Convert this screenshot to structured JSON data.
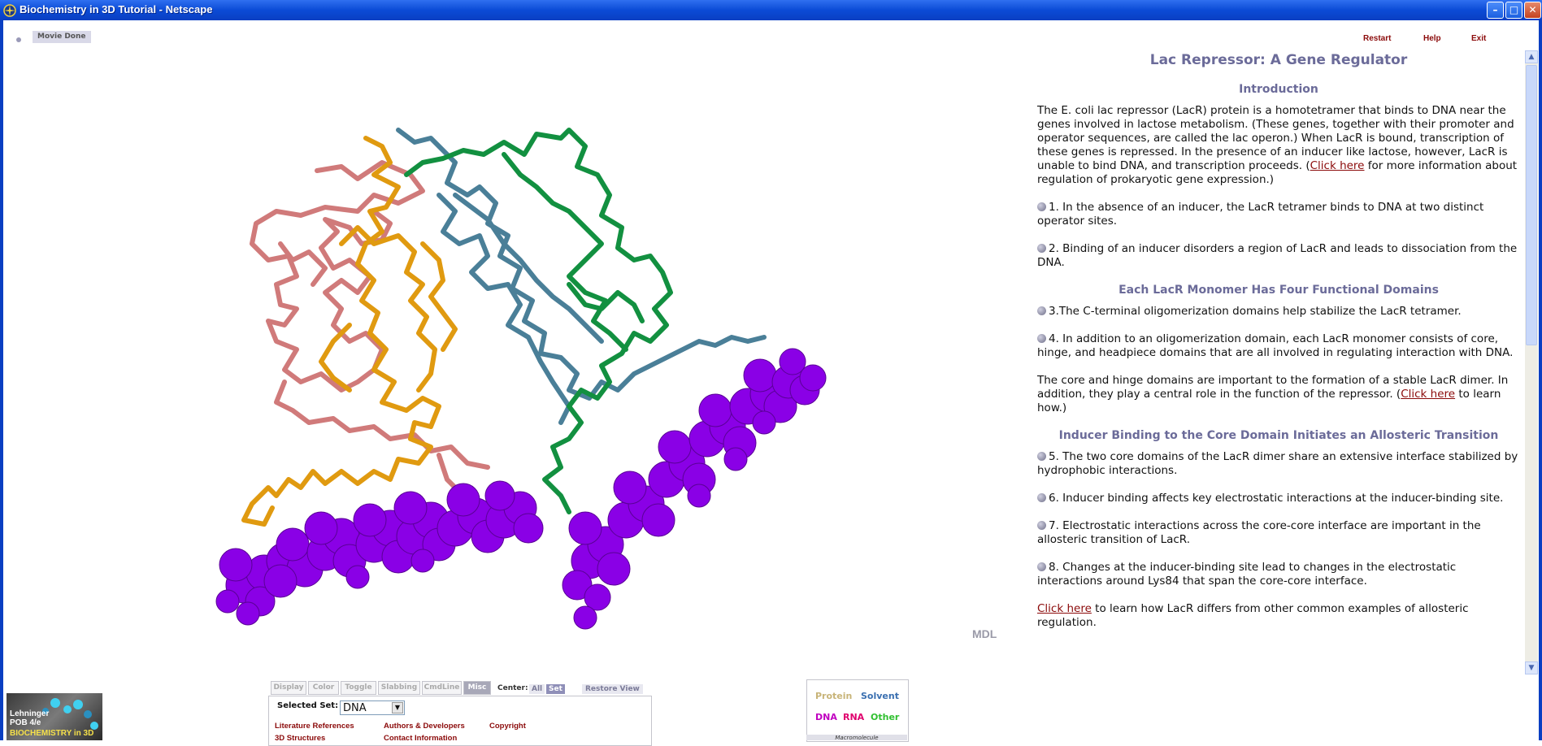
{
  "window": {
    "title": "Biochemistry in 3D Tutorial - Netscape",
    "minimize_glyph": "–",
    "maximize_glyph": "□",
    "close_glyph": "✕"
  },
  "toolbar": {
    "movie_label": "Movie Done"
  },
  "top_nav": {
    "restart": "Restart",
    "help": "Help",
    "exit": "Exit"
  },
  "content": {
    "title": "Lac Repressor: A Gene Regulator",
    "intro_heading": "Introduction",
    "intro_text_1": "The E. coli lac repressor (LacR) protein is a homotetramer that binds to DNA near the genes involved in lactose metabolism. (These genes, together with their promoter and operator sequences, are called the lac operon.) When LacR is bound, transcription of these genes is repressed. In the presence of an inducer like lactose, however, LacR is unable to bind DNA, and transcription proceeds. (",
    "intro_link": "Click here",
    "intro_text_2": " for more information about regulation of prokaryotic gene expression.)",
    "step1": "1. In the absence of an inducer, the LacR tetramer binds to DNA at two distinct operator sites.",
    "step2": "2. Binding of an inducer disorders a region of LacR and leads to dissociation from the DNA.",
    "domains_heading": "Each LacR Monomer Has Four Functional Domains",
    "step3": "3.The C-terminal oligomerization domains help stabilize the LacR tetramer.",
    "step4": "4. In addition to an oligomerization domain, each LacR monomer consists of core, hinge, and headpiece domains that are all involved in regulating interaction with DNA.",
    "core_text_1": "The core and hinge domains are important to the formation of a stable LacR dimer. In addition, they play a central role in the function of the repressor. (",
    "core_link": "Click here",
    "core_text_2": " to learn how.)",
    "inducer_heading": "Inducer Binding to the Core Domain Initiates an Allosteric Transition",
    "step5": "5. The two core domains of the LacR dimer share an extensive interface stabilized by hydrophobic interactions.",
    "step6": "6. Inducer binding affects key electrostatic interactions at the inducer-binding site.",
    "step7": "7. Electrostatic interactions across the core-core interface are important in the allosteric transition of LacR.",
    "step8": "8. Changes at the inducer-binding site lead to changes in the electrostatic interactions around Lys84 that span the core-core interface.",
    "last_link": "Click here",
    "last_text": " to learn how LacR differs from other common examples of allosteric regulation."
  },
  "viewer": {
    "watermark": "MDL"
  },
  "controls": {
    "tabs": [
      "Display",
      "Color",
      "Toggle",
      "Slabbing",
      "CmdLine",
      "Misc"
    ],
    "active_tab": "Misc",
    "center_label": "Center:",
    "center_all": "All",
    "center_set": "Set",
    "restore_view": "Restore View",
    "selected_set_label": "Selected Set:",
    "selected_set_value": "DNA",
    "links": [
      "Literature References",
      "Authors & Developers",
      "Copyright",
      "3D Structures",
      "Contact Information"
    ]
  },
  "legend": {
    "protein": "Protein",
    "solvent": "Solvent",
    "dna": "DNA",
    "rna": "RNA",
    "other": "Other",
    "footer": "Macromolecule",
    "colors": {
      "protein": "#c8b478",
      "solvent": "#3a6fb0",
      "dna": "#c000c0",
      "rna": "#e0006e",
      "other": "#30c030"
    }
  },
  "logo": {
    "line1": "Lehninger",
    "line2": "POB 4/e",
    "line3": "BIOCHEMISTRY in 3D"
  },
  "colors": {
    "accent_heading": "#6b6b99",
    "link": "#8b0a0a",
    "dna": "#8a00e6",
    "chain_pink": "#d07a7a",
    "chain_orange": "#e09a10",
    "chain_blue": "#4a7f98",
    "chain_green": "#129040"
  }
}
